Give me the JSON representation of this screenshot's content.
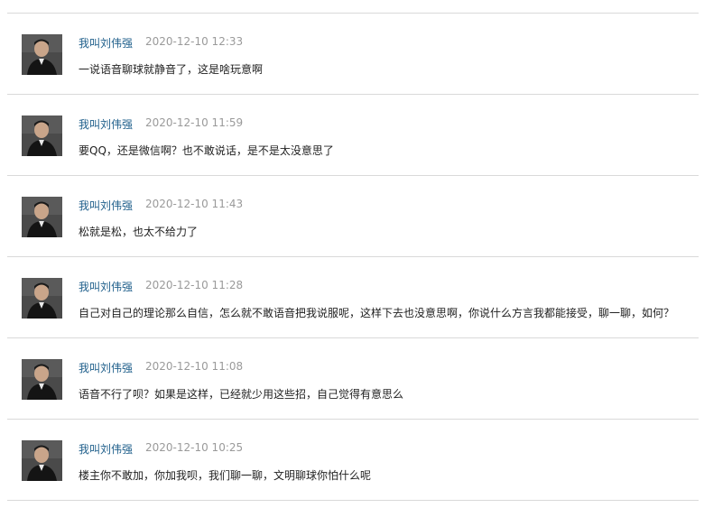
{
  "comments": [
    {
      "username": "我叫刘伟强",
      "time": "2020-12-10 12:33",
      "text": "一说语音聊球就静音了，这是啥玩意啊",
      "avatar_icon": "user-avatar-photo"
    },
    {
      "username": "我叫刘伟强",
      "time": "2020-12-10 11:59",
      "text": "要QQ，还是微信啊？也不敢说话，是不是太没意思了",
      "avatar_icon": "user-avatar-photo"
    },
    {
      "username": "我叫刘伟强",
      "time": "2020-12-10 11:43",
      "text": "松就是松，也太不给力了",
      "avatar_icon": "user-avatar-photo"
    },
    {
      "username": "我叫刘伟强",
      "time": "2020-12-10 11:28",
      "text": "自己对自己的理论那么自信，怎么就不敢语音把我说服呢，这样下去也没意思啊，你说什么方言我都能接受，聊一聊，如何？",
      "avatar_icon": "user-avatar-photo"
    },
    {
      "username": "我叫刘伟强",
      "time": "2020-12-10 11:08",
      "text": "语音不行了呗？如果是这样，已经就少用这些招，自己觉得有意思么",
      "avatar_icon": "user-avatar-photo"
    },
    {
      "username": "我叫刘伟强",
      "time": "2020-12-10 10:25",
      "text": "楼主你不敢加，你加我呗，我们聊一聊，文明聊球你怕什么呢",
      "avatar_icon": "user-avatar-photo"
    }
  ],
  "colors": {
    "username": "#1f5f8b",
    "timestamp": "#9a9a9a",
    "text": "#222222",
    "divider": "#d9d9d9"
  }
}
